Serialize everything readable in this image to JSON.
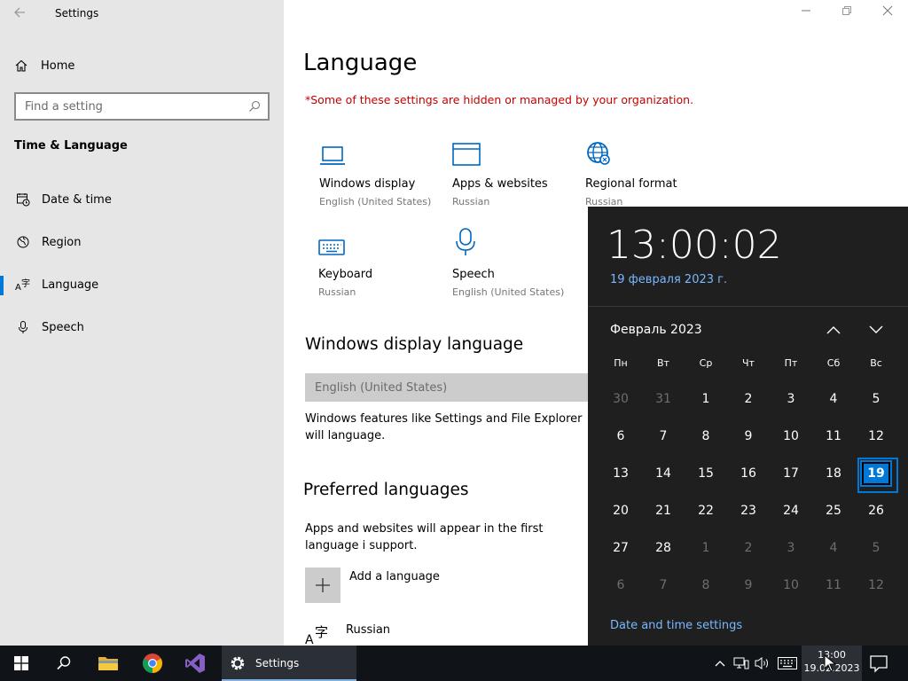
{
  "app": {
    "title": "Settings"
  },
  "window_controls": {
    "minimize": "—",
    "maximize": "❐",
    "close": "✕"
  },
  "sidebar": {
    "home_label": "Home",
    "search_placeholder": "Find a setting",
    "section_title": "Time & Language",
    "items": [
      {
        "label": "Date & time",
        "icon": "calendar-clock-icon",
        "active": false
      },
      {
        "label": "Region",
        "icon": "globe-icon",
        "active": false
      },
      {
        "label": "Language",
        "icon": "language-icon",
        "active": true
      },
      {
        "label": "Speech",
        "icon": "microphone-icon",
        "active": false
      }
    ]
  },
  "main": {
    "title": "Language",
    "org_note": "*Some of these settings are hidden or managed by your organization.",
    "tiles": [
      {
        "title": "Windows display",
        "subtitle": "English (United States)",
        "icon": "laptop-icon"
      },
      {
        "title": "Apps & websites",
        "subtitle": "Russian",
        "icon": "browser-window-icon"
      },
      {
        "title": "Regional format",
        "subtitle": "Russian",
        "icon": "globe-settings-icon"
      },
      {
        "title": "Keyboard",
        "subtitle": "Russian",
        "icon": "keyboard-icon"
      },
      {
        "title": "Speech",
        "subtitle": "English (United States)",
        "icon": "microphone-icon"
      }
    ],
    "display_language": {
      "heading": "Windows display language",
      "value": "English (United States)",
      "description": "Windows features like Settings and File Explorer will language."
    },
    "preferred": {
      "heading": "Preferred languages",
      "description": "Apps and websites will appear in the first language i support.",
      "add_label": "Add a language",
      "languages": [
        {
          "name": "Russian",
          "icon": "language-icon"
        }
      ]
    }
  },
  "flyout": {
    "time": "13:00:02",
    "date": "19 февраля 2023 г.",
    "month_label": "Февраль 2023",
    "weekdays": [
      "Пн",
      "Вт",
      "Ср",
      "Чт",
      "Пт",
      "Сб",
      "Вс"
    ],
    "days": [
      {
        "d": "30",
        "o": true
      },
      {
        "d": "31",
        "o": true
      },
      {
        "d": "1"
      },
      {
        "d": "2"
      },
      {
        "d": "3"
      },
      {
        "d": "4"
      },
      {
        "d": "5"
      },
      {
        "d": "6"
      },
      {
        "d": "7"
      },
      {
        "d": "8"
      },
      {
        "d": "9"
      },
      {
        "d": "10"
      },
      {
        "d": "11"
      },
      {
        "d": "12"
      },
      {
        "d": "13"
      },
      {
        "d": "14"
      },
      {
        "d": "15"
      },
      {
        "d": "16"
      },
      {
        "d": "17"
      },
      {
        "d": "18"
      },
      {
        "d": "19",
        "today": true
      },
      {
        "d": "20"
      },
      {
        "d": "21"
      },
      {
        "d": "22"
      },
      {
        "d": "23"
      },
      {
        "d": "24"
      },
      {
        "d": "25"
      },
      {
        "d": "26"
      },
      {
        "d": "27"
      },
      {
        "d": "28"
      },
      {
        "d": "1",
        "o": true
      },
      {
        "d": "2",
        "o": true
      },
      {
        "d": "3",
        "o": true
      },
      {
        "d": "4",
        "o": true
      },
      {
        "d": "5",
        "o": true
      },
      {
        "d": "6",
        "o": true
      },
      {
        "d": "7",
        "o": true
      },
      {
        "d": "8",
        "o": true
      },
      {
        "d": "9",
        "o": true
      },
      {
        "d": "10",
        "o": true
      },
      {
        "d": "11",
        "o": true
      },
      {
        "d": "12",
        "o": true
      }
    ],
    "settings_link": "Date and time settings"
  },
  "taskbar": {
    "settings_label": "Settings",
    "clock_time": "13:00",
    "clock_date": "19.02.2023",
    "accent": "#0078d7"
  }
}
